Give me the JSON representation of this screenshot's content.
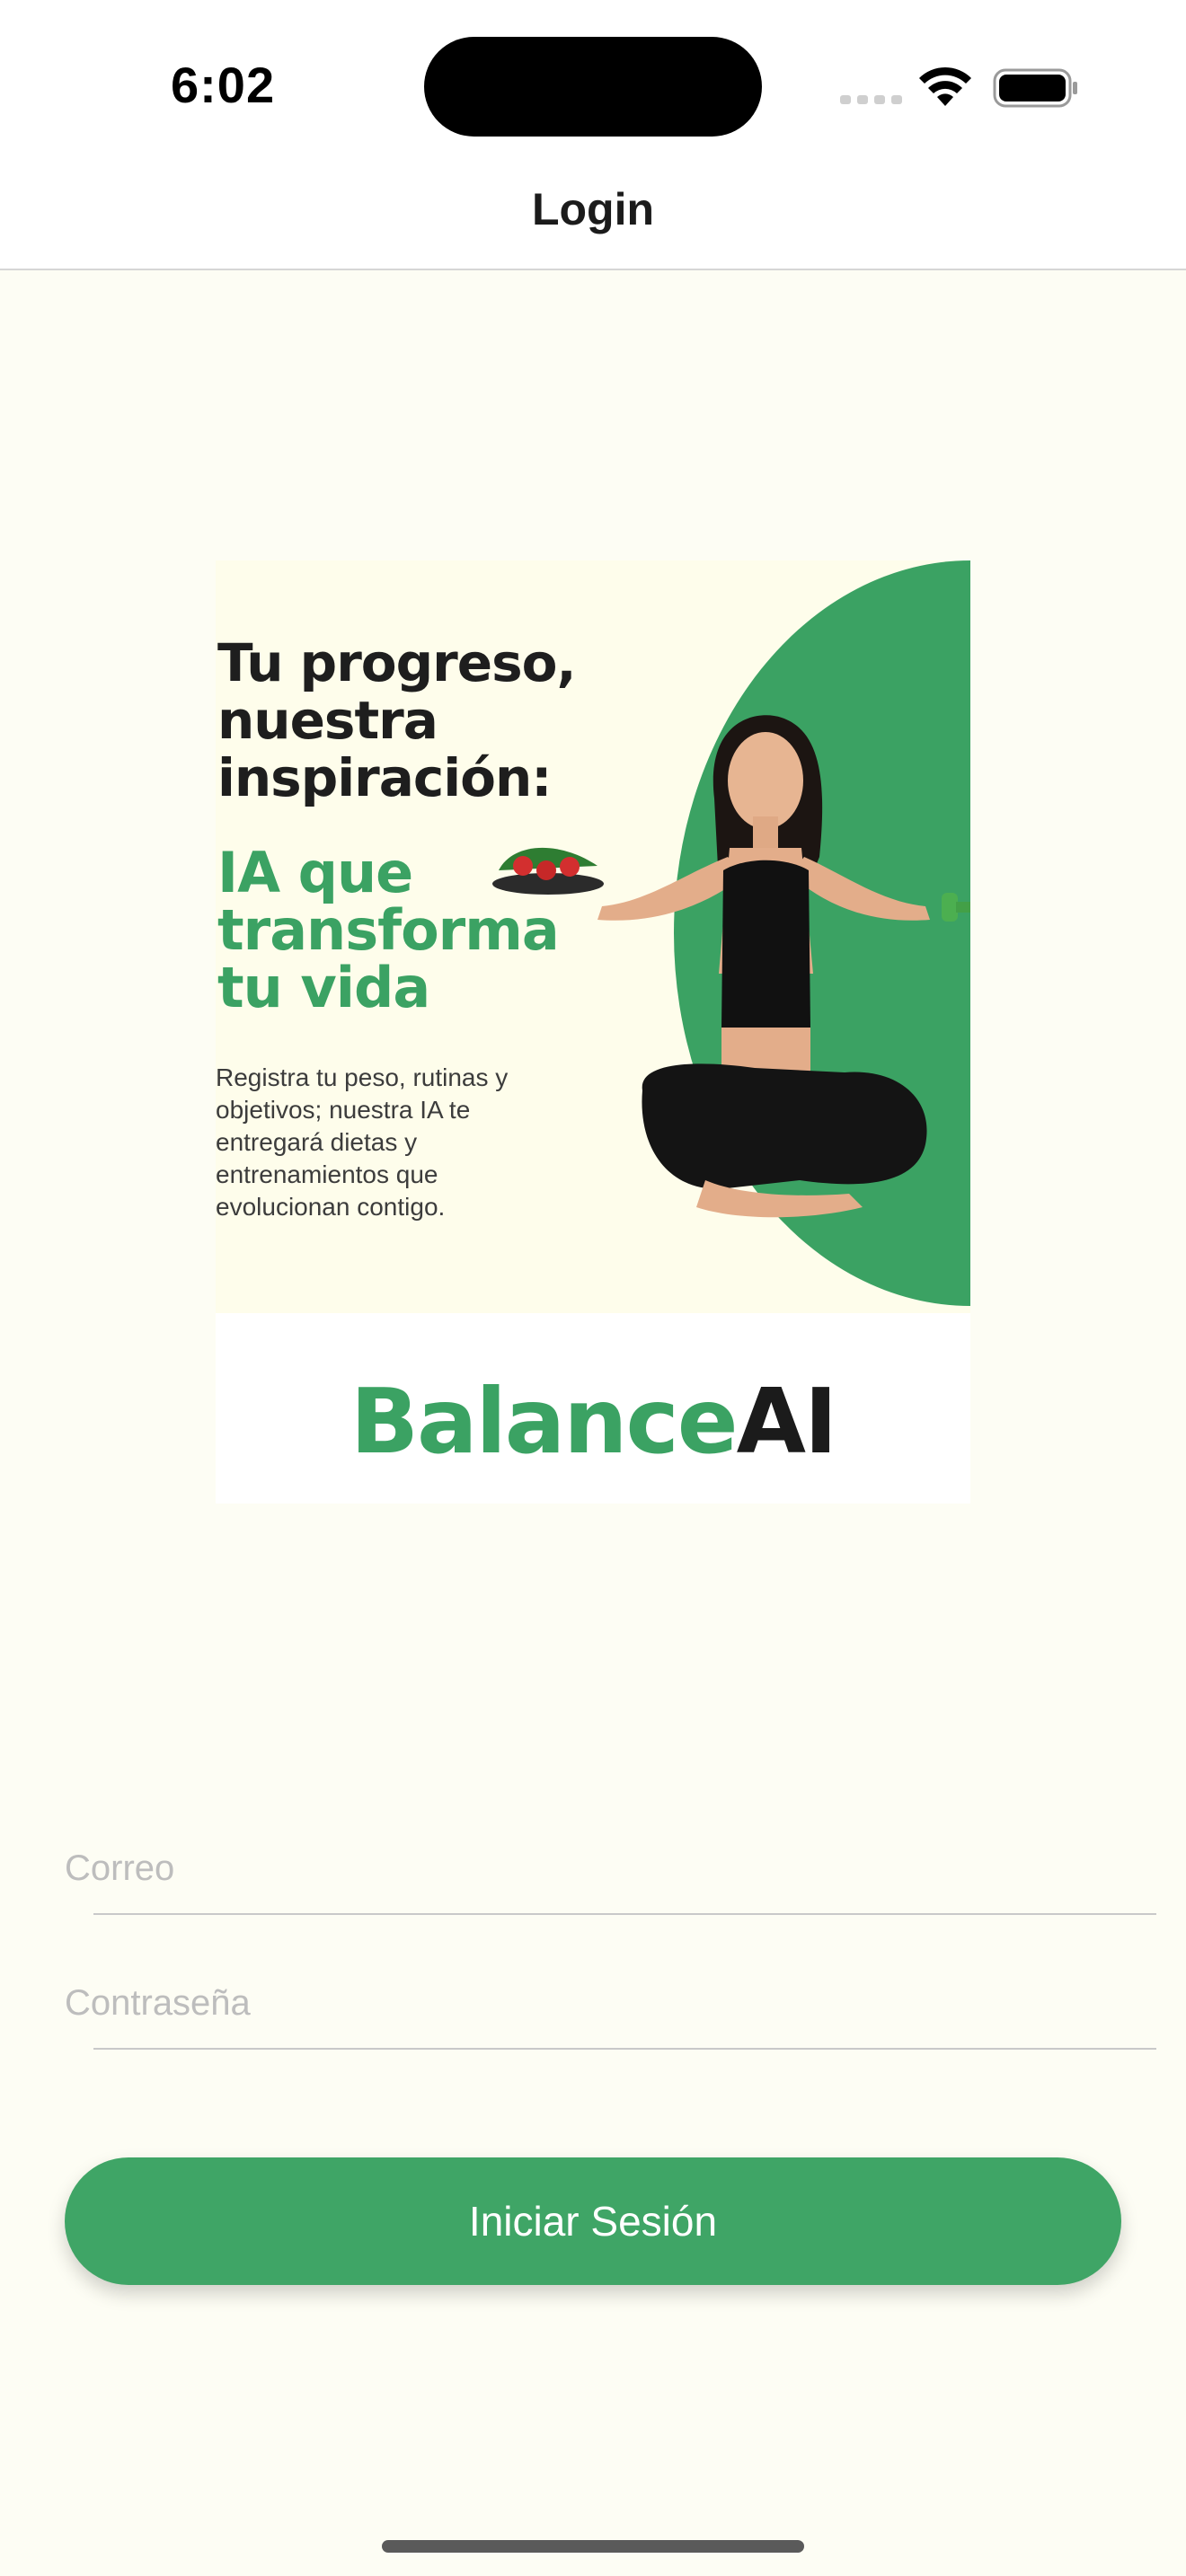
{
  "status_bar": {
    "time": "6:02"
  },
  "nav": {
    "title": "Login"
  },
  "hero": {
    "headline_lines": [
      "Tu progreso,",
      "nuestra",
      "inspiración:"
    ],
    "subheadline_lines": [
      "IA que",
      "transforma",
      "tu vida"
    ],
    "description_lines": [
      "Registra tu peso, rutinas y",
      "objetivos; nuestra IA te",
      "entregará dietas y",
      "entrenamientos que",
      "evolucionan contigo."
    ],
    "brand_part1": "Balance",
    "brand_part2": "AI"
  },
  "form": {
    "email_placeholder": "Correo",
    "email_value": "",
    "password_placeholder": "Contraseña",
    "password_value": "",
    "submit_label": "Iniciar Sesión"
  },
  "colors": {
    "accent": "#3FA566",
    "background": "#FDFDF4",
    "hero_background": "#FEFDEB"
  }
}
